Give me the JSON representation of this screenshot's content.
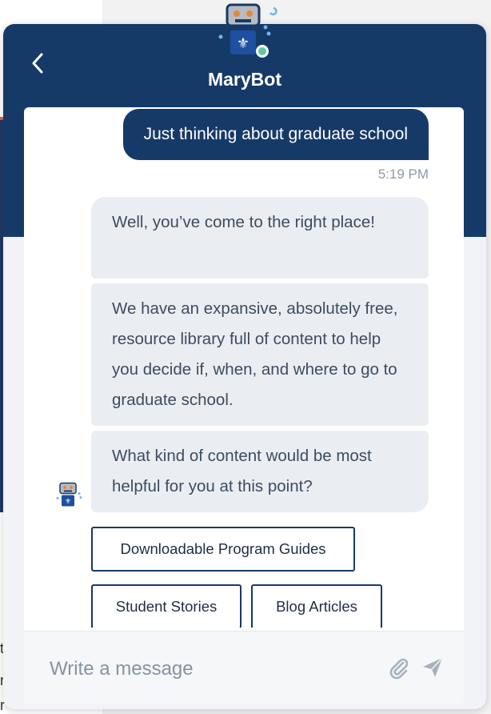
{
  "header": {
    "bot_name": "MaryBot"
  },
  "conversation": {
    "user_message": "Just thinking about graduate school",
    "timestamp": "5:19 PM",
    "bot_messages": [
      "Well, you’ve come to the right place!",
      "We have an expansive, absolutely free, resource library full of content to help you decide if, when, and where to go to graduate school.",
      "What kind of content would be most helpful for you at this point?"
    ]
  },
  "quick_replies": [
    "Downloadable Program Guides",
    "Student Stories",
    "Blog Articles"
  ],
  "composer": {
    "placeholder": "Write a message"
  },
  "background": {
    "fragments": [
      "t",
      "r",
      "r"
    ]
  },
  "colors": {
    "header": "#163a68",
    "bot_bubble": "#eaeef3",
    "online_indicator": "#5ec9a6"
  },
  "icons": [
    "back-chevron-icon",
    "robot-avatar-icon",
    "fleur-de-lis-icon",
    "attachment-icon",
    "send-icon"
  ]
}
